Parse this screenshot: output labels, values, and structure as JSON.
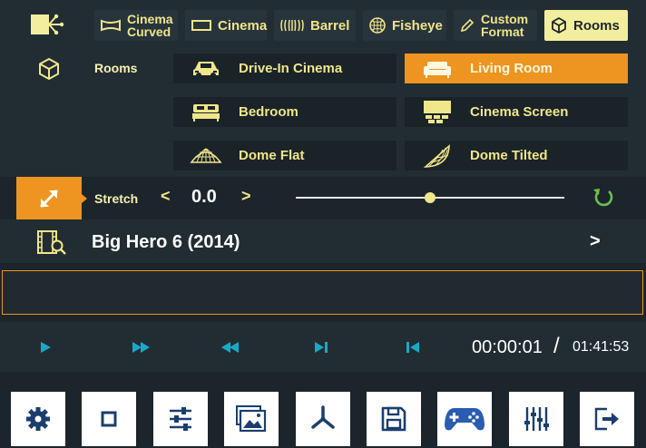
{
  "formats": {
    "items": [
      {
        "label_line1": "Cinema",
        "label_line2": "Curved"
      },
      {
        "label": "Cinema"
      },
      {
        "label": "Barrel"
      },
      {
        "label": "Fisheye"
      },
      {
        "label_line1": "Custom",
        "label_line2": "Format"
      },
      {
        "label": "Rooms",
        "active": true
      }
    ]
  },
  "rooms": {
    "title": "Rooms",
    "items": [
      {
        "label": "Drive-In Cinema",
        "icon": "car-icon"
      },
      {
        "label": "Living Room",
        "icon": "sofa-icon",
        "active": true
      },
      {
        "label": "Bedroom",
        "icon": "bed-icon"
      },
      {
        "label": "Cinema Screen",
        "icon": "cinema-screen-icon"
      },
      {
        "label": "Dome Flat",
        "icon": "dome-flat-icon"
      },
      {
        "label": "Dome Tilted",
        "icon": "dome-tilted-icon"
      }
    ]
  },
  "stretch": {
    "label": "Stretch",
    "dec": "<",
    "inc": ">",
    "value": "0.0",
    "slider_fraction": 0.5
  },
  "media": {
    "title": "Big Hero 6 (2014)",
    "chevron": ">"
  },
  "playback": {
    "current_time": "00:00:01",
    "separator": "/",
    "total_time": "01:41:53"
  },
  "colors": {
    "accent": "#ee9420",
    "highlight": "#f0e68a",
    "transport": "#1aa8c8"
  }
}
